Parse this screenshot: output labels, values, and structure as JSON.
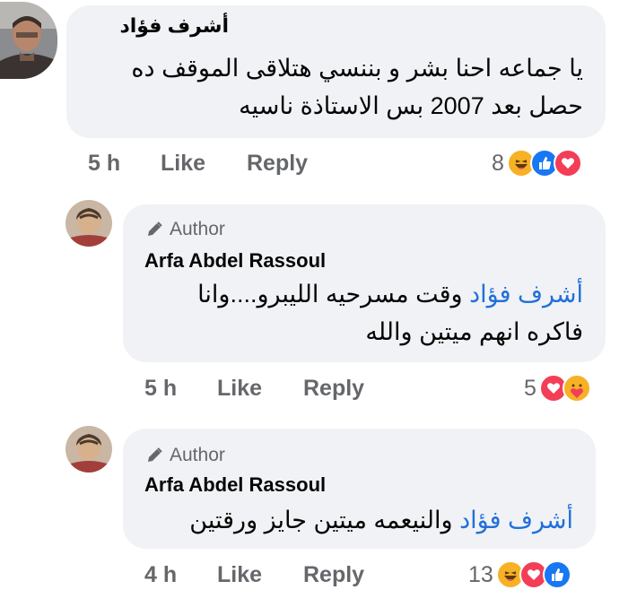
{
  "comments": [
    {
      "author": "أشرف فؤاد",
      "text_lines": [
        "يا جماعه احنا بشر و بننسي هتلاقى الموقف ده",
        "حصل بعد 2007 بس الاستاذة ناسيه"
      ],
      "time": "5 h",
      "like_label": "Like",
      "reply_label": "Reply",
      "reaction_count": "8",
      "reactions": [
        "haha-icon",
        "like-icon",
        "love-icon"
      ]
    },
    {
      "badge": "Author",
      "author": "Arfa Abdel Rassoul",
      "mention": "أشرف فؤاد",
      "text_line1_rest": "وقت مسرحيه الليبرو....وانا",
      "text_line2": "فاكره انهم ميتين والله",
      "time": "5 h",
      "like_label": "Like",
      "reply_label": "Reply",
      "reaction_count": "5",
      "reactions": [
        "love-icon",
        "care-icon"
      ]
    },
    {
      "badge": "Author",
      "author": "Arfa Abdel Rassoul",
      "mention": "أشرف فؤاد",
      "text_line1_rest": "والنيعمه ميتين جايز ورقتين",
      "time": "4 h",
      "like_label": "Like",
      "reply_label": "Reply",
      "reaction_count": "13",
      "reactions": [
        "haha-icon",
        "love-icon",
        "like-icon"
      ]
    }
  ],
  "colors": {
    "bubble": "#f0f2f5",
    "mention": "#216fdb",
    "meta": "#65676b",
    "like_blue": "#1877f2",
    "love_red": "#f33e58",
    "haha_yellow": "#f7b125"
  }
}
